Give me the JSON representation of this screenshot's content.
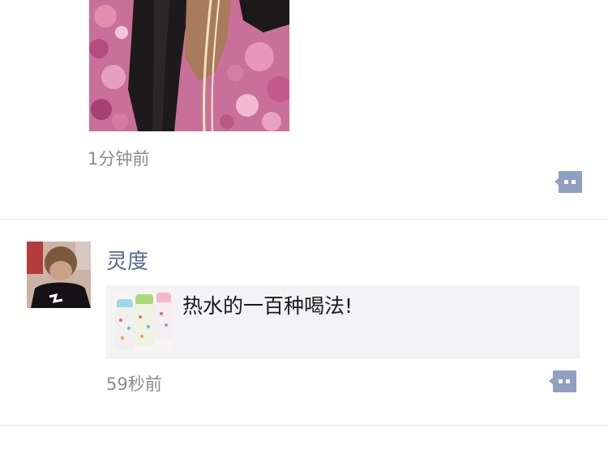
{
  "post1": {
    "time": "1分钟前",
    "photo_icon": "photo-image",
    "comment_icon": "comment-bubble-icon"
  },
  "post2": {
    "username": "灵度",
    "avatar_icon": "user-avatar-image",
    "link": {
      "title": "热水的一百种喝法!",
      "thumb_icon": "thermos-bottles-image"
    },
    "time": "59秒前",
    "comment_icon": "comment-bubble-icon"
  },
  "colors": {
    "username": "#576b95",
    "timestamp": "#8c8c8c",
    "comment_button": "#8fa0c3",
    "link_card_bg": "#f3f3f5",
    "divider": "#e3e3e3"
  }
}
